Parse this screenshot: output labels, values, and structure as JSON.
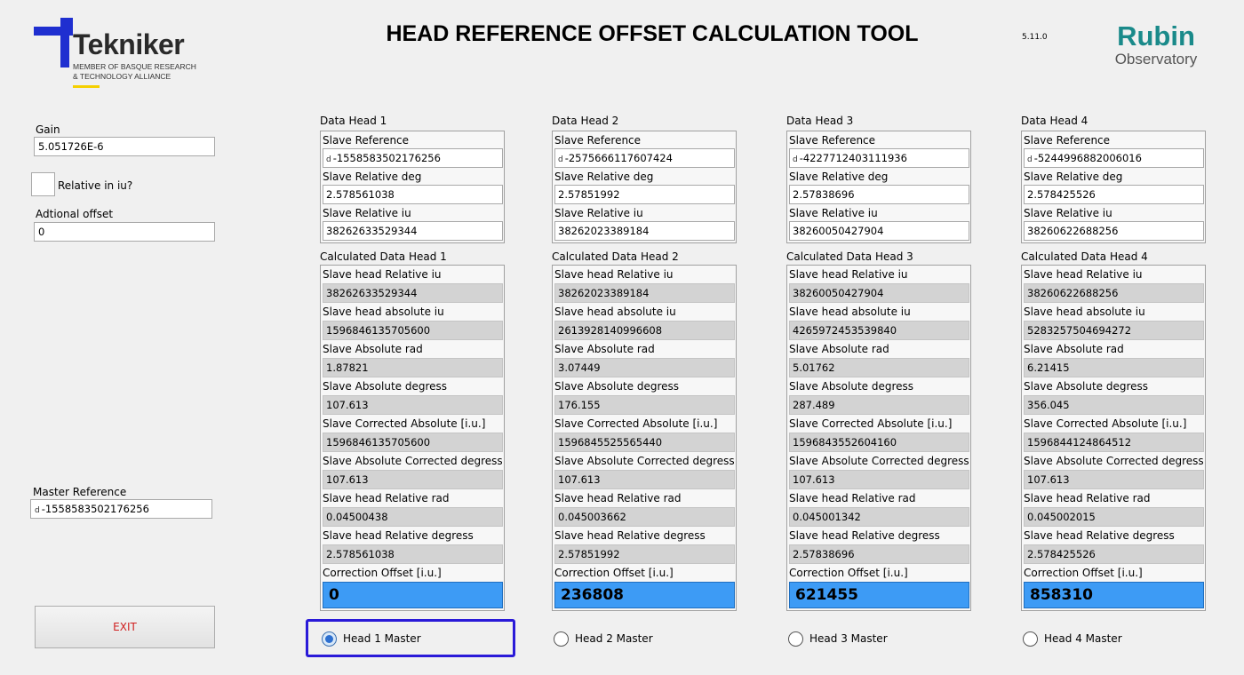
{
  "header": {
    "logo": {
      "name": "Tekniker",
      "tagline": "MEMBER OF BASQUE RESEARCH\n& TECHNOLOGY ALLIANCE"
    },
    "title": "HEAD REFERENCE OFFSET CALCULATION TOOL",
    "version": "5.11.0",
    "partner_logo": {
      "line1": "Rubin",
      "line2": "Observatory"
    }
  },
  "left": {
    "gain_label": "Gain",
    "gain_value": "5.051726E-6",
    "relative_label": "Relative in iu?",
    "additional_offset_label": "Adtional offset",
    "additional_offset_value": "0",
    "master_reference_label": "Master Reference",
    "master_reference_prefix": "d",
    "master_reference_value": "-1558583502176256",
    "exit_label": "EXIT"
  },
  "field_labels": {
    "slave_reference": "Slave Reference",
    "slave_relative_deg": "Slave Relative deg",
    "slave_relative_iu": "Slave Relative iu",
    "slave_head_relative_iu": "Slave head Relative iu",
    "slave_head_absolute_iu": "Slave head absolute iu",
    "slave_absolute_rad": "Slave Absolute rad",
    "slave_absolute_degress": "Slave Absolute degress",
    "slave_corrected_absolute": "Slave Corrected Absolute [i.u.]",
    "slave_absolute_corrected_degress": "Slave Absolute Corrected degress",
    "slave_head_relative_rad": "Slave head Relative rad",
    "slave_head_relative_degress": "Slave head Relative degress",
    "correction_offset": "Correction Offset [i.u.]",
    "ref_prefix": "d"
  },
  "heads": [
    {
      "data_title": "Data Head 1",
      "calc_title": "Calculated Data Head 1",
      "slave_reference": "-1558583502176256",
      "slave_relative_deg": "2.578561038",
      "slave_relative_iu": "38262633529344",
      "slave_head_relative_iu": "38262633529344",
      "slave_head_absolute_iu": "1596846135705600",
      "slave_absolute_rad": "1.87821",
      "slave_absolute_degress": "107.613",
      "slave_corrected_absolute": "1596846135705600",
      "slave_absolute_corrected_degress": "107.613",
      "slave_head_relative_rad": "0.04500438",
      "slave_head_relative_degress": "2.578561038",
      "correction_offset": "0",
      "master_label": "Head 1 Master",
      "master_selected": true
    },
    {
      "data_title": "Data Head 2",
      "calc_title": "Calculated Data Head 2",
      "slave_reference": "-2575666117607424",
      "slave_relative_deg": "2.57851992",
      "slave_relative_iu": "38262023389184",
      "slave_head_relative_iu": "38262023389184",
      "slave_head_absolute_iu": "2613928140996608",
      "slave_absolute_rad": "3.07449",
      "slave_absolute_degress": "176.155",
      "slave_corrected_absolute": "1596845525565440",
      "slave_absolute_corrected_degress": "107.613",
      "slave_head_relative_rad": "0.045003662",
      "slave_head_relative_degress": "2.57851992",
      "correction_offset": "236808",
      "master_label": "Head 2 Master",
      "master_selected": false
    },
    {
      "data_title": "Data Head 3",
      "calc_title": "Calculated Data Head 3",
      "slave_reference": "-4227712403111936",
      "slave_relative_deg": "2.57838696",
      "slave_relative_iu": "38260050427904",
      "slave_head_relative_iu": "38260050427904",
      "slave_head_absolute_iu": "4265972453539840",
      "slave_absolute_rad": "5.01762",
      "slave_absolute_degress": "287.489",
      "slave_corrected_absolute": "1596843552604160",
      "slave_absolute_corrected_degress": "107.613",
      "slave_head_relative_rad": "0.045001342",
      "slave_head_relative_degress": "2.57838696",
      "correction_offset": "621455",
      "master_label": "Head 3 Master",
      "master_selected": false
    },
    {
      "data_title": "Data Head 4",
      "calc_title": "Calculated Data Head 4",
      "slave_reference": "-5244996882006016",
      "slave_relative_deg": "2.578425526",
      "slave_relative_iu": "38260622688256",
      "slave_head_relative_iu": "38260622688256",
      "slave_head_absolute_iu": "5283257504694272",
      "slave_absolute_rad": "6.21415",
      "slave_absolute_degress": "356.045",
      "slave_corrected_absolute": "1596844124864512",
      "slave_absolute_corrected_degress": "107.613",
      "slave_head_relative_rad": "0.045002015",
      "slave_head_relative_degress": "2.578425526",
      "correction_offset": "858310",
      "master_label": "Head 4 Master",
      "master_selected": false
    }
  ],
  "colors": {
    "accent_blue": "#3d9bf5",
    "exit_text": "#d02020",
    "focus_border": "#2a1ad8",
    "brand_blue": "#1f2fd0",
    "rubin_teal": "#1a8a8a"
  }
}
